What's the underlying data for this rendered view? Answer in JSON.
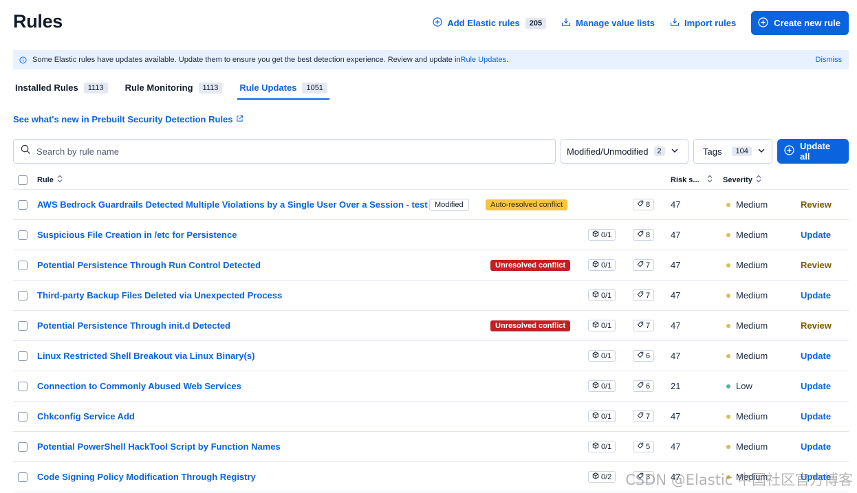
{
  "header": {
    "title": "Rules",
    "add_elastic_label": "Add Elastic rules",
    "add_elastic_count": "205",
    "manage_lists_label": "Manage value lists",
    "import_label": "Import rules",
    "create_label": "Create new rule"
  },
  "callout": {
    "text": "Some Elastic rules have updates available. Update them to ensure you get the best detection experience. Review and update in ",
    "link": "Rule Updates",
    "suffix": ".",
    "dismiss": "Dismiss"
  },
  "tabs": [
    {
      "label": "Installed Rules",
      "count": "1113"
    },
    {
      "label": "Rule Monitoring",
      "count": "1113"
    },
    {
      "label": "Rule Updates",
      "count": "1051"
    }
  ],
  "whatsnew": "See what's new in Prebuilt Security Detection Rules",
  "search": {
    "placeholder": "Search by rule name"
  },
  "filters": {
    "modified_label": "Modified/Unmodified",
    "modified_count": "2",
    "tags_label": "Tags",
    "tags_count": "104",
    "update_all": "Update all"
  },
  "table": {
    "col_rule": "Rule",
    "col_risk": "Risk s...",
    "col_severity": "Severity",
    "rows": [
      {
        "name": "AWS Bedrock Guardrails Detected Multiple Violations by a Single User Over a Session - test",
        "modified": "Modified",
        "conflict": "Auto-resolved conflict",
        "conflict_type": "auto",
        "version": "",
        "tags": "8",
        "risk": "47",
        "severity": "Medium",
        "action": "Review"
      },
      {
        "name": "Suspicious File Creation in /etc for Persistence",
        "modified": "",
        "conflict": "",
        "conflict_type": "",
        "version": "0/1",
        "tags": "8",
        "risk": "47",
        "severity": "Medium",
        "action": "Update"
      },
      {
        "name": "Potential Persistence Through Run Control Detected",
        "modified": "",
        "conflict": "Unresolved conflict",
        "conflict_type": "unresolved",
        "version": "0/1",
        "tags": "7",
        "risk": "47",
        "severity": "Medium",
        "action": "Review"
      },
      {
        "name": "Third-party Backup Files Deleted via Unexpected Process",
        "modified": "",
        "conflict": "",
        "conflict_type": "",
        "version": "0/1",
        "tags": "7",
        "risk": "47",
        "severity": "Medium",
        "action": "Update"
      },
      {
        "name": "Potential Persistence Through init.d Detected",
        "modified": "",
        "conflict": "Unresolved conflict",
        "conflict_type": "unresolved",
        "version": "0/1",
        "tags": "7",
        "risk": "47",
        "severity": "Medium",
        "action": "Review"
      },
      {
        "name": "Linux Restricted Shell Breakout via Linux Binary(s)",
        "modified": "",
        "conflict": "",
        "conflict_type": "",
        "version": "0/1",
        "tags": "6",
        "risk": "47",
        "severity": "Medium",
        "action": "Update"
      },
      {
        "name": "Connection to Commonly Abused Web Services",
        "modified": "",
        "conflict": "",
        "conflict_type": "",
        "version": "0/1",
        "tags": "6",
        "risk": "21",
        "severity": "Low",
        "action": "Update"
      },
      {
        "name": "Chkconfig Service Add",
        "modified": "",
        "conflict": "",
        "conflict_type": "",
        "version": "0/1",
        "tags": "7",
        "risk": "47",
        "severity": "Medium",
        "action": "Update"
      },
      {
        "name": "Potential PowerShell HackTool Script by Function Names",
        "modified": "",
        "conflict": "",
        "conflict_type": "",
        "version": "0/1",
        "tags": "5",
        "risk": "47",
        "severity": "Medium",
        "action": "Update"
      },
      {
        "name": "Code Signing Policy Modification Through Registry",
        "modified": "",
        "conflict": "",
        "conflict_type": "",
        "version": "0/2",
        "tags": "3",
        "risk": "47",
        "severity": "Medium",
        "action": "Update"
      }
    ]
  },
  "colors": {
    "accent": "#0b64dd",
    "medium": "#d6bf57",
    "low": "#54b399",
    "unresolved": "#c61e25",
    "auto": "#f6c53f"
  },
  "watermark": "CSDN @Elastic 中国社区官方博客"
}
